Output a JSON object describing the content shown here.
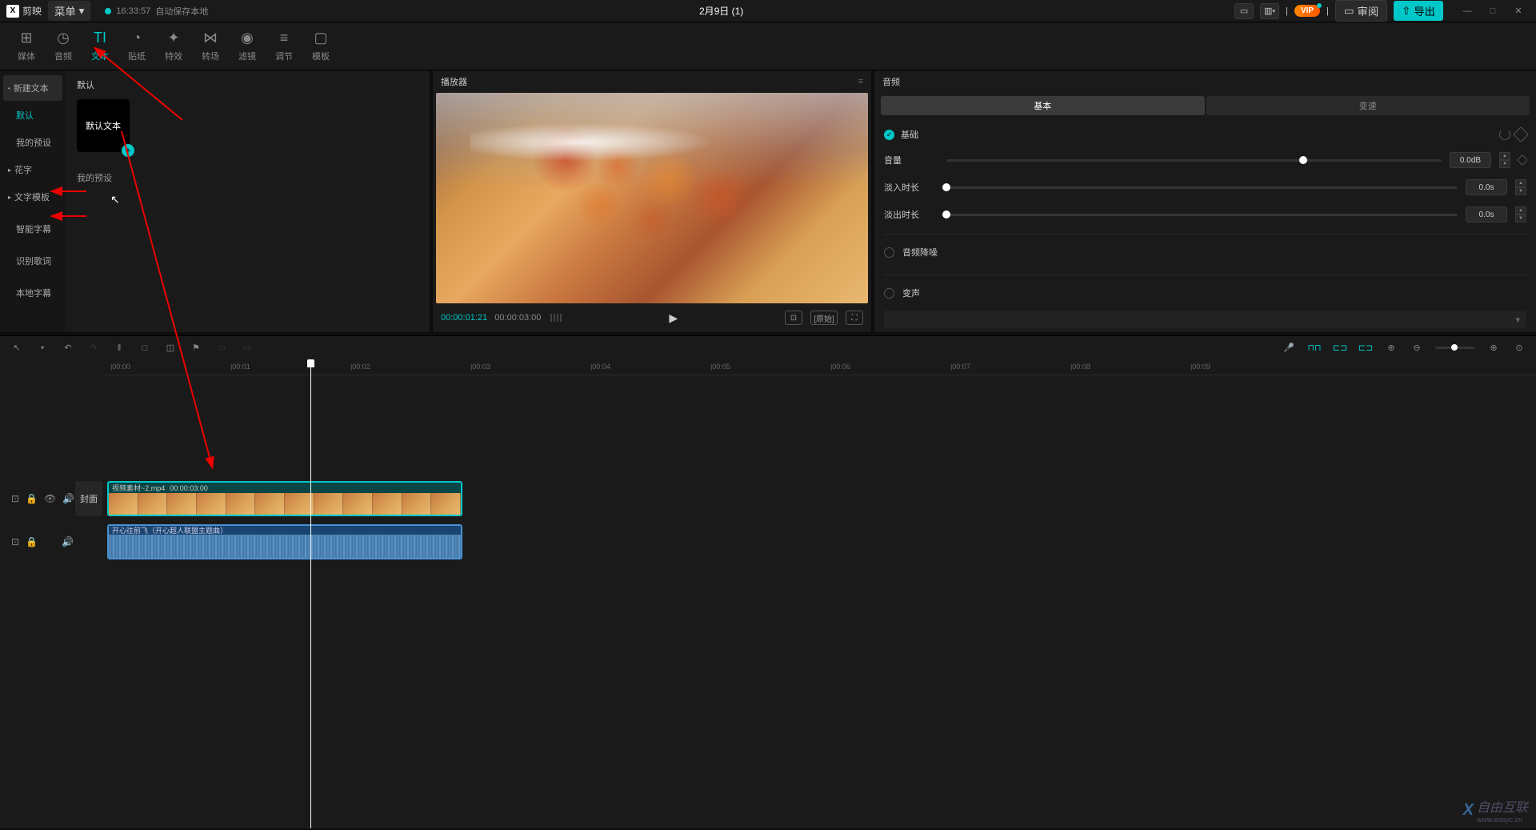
{
  "titlebar": {
    "app_name": "剪映",
    "menu_btn": "菜单",
    "autosave_time": "16:33:57",
    "autosave_text": "自动保存本地",
    "project_title": "2月9日 (1)",
    "vip": "VIP",
    "review": "审阅",
    "export": "导出"
  },
  "main_tabs": [
    {
      "icon": "⊞",
      "label": "媒体"
    },
    {
      "icon": "◷",
      "label": "音频"
    },
    {
      "icon": "TI",
      "label": "文本"
    },
    {
      "icon": "◔",
      "label": "贴纸"
    },
    {
      "icon": "✦",
      "label": "特效"
    },
    {
      "icon": "⋈",
      "label": "转场"
    },
    {
      "icon": "◉",
      "label": "滤镜"
    },
    {
      "icon": "≡",
      "label": "调节"
    },
    {
      "icon": "▢",
      "label": "模板"
    }
  ],
  "sidebar": {
    "items": [
      {
        "label": "新建文本",
        "variant": "primary",
        "bullet": true
      },
      {
        "label": "默认",
        "variant": "sub-active"
      },
      {
        "label": "我的预设",
        "variant": "sub"
      },
      {
        "label": "花字",
        "variant": "caret"
      },
      {
        "label": "文字模板",
        "variant": "caret"
      },
      {
        "label": "智能字幕",
        "variant": "plain"
      },
      {
        "label": "识别歌词",
        "variant": "plain"
      },
      {
        "label": "本地字幕",
        "variant": "plain"
      }
    ]
  },
  "content": {
    "section_default": "默认",
    "default_text_card": "默认文本",
    "my_presets": "我的预设"
  },
  "preview": {
    "title": "播放器",
    "time_current": "00:00:01:21",
    "time_total": "00:00:03:00",
    "ratio_label": "[原始]"
  },
  "audio": {
    "title": "音频",
    "tab_basic": "基本",
    "tab_variable": "变速",
    "section_basic": "基础",
    "volume_label": "音量",
    "volume_value": "0.0dB",
    "fadein_label": "淡入时长",
    "fadein_value": "0.0s",
    "fadeout_label": "淡出时长",
    "fadeout_value": "0.0s",
    "noise_label": "音频降噪",
    "voice_label": "变声"
  },
  "ruler": {
    "ticks": [
      {
        "label": "00:00",
        "pos": 8
      },
      {
        "label": "00:01",
        "pos": 158
      },
      {
        "label": "00:02",
        "pos": 308
      },
      {
        "label": "00:03",
        "pos": 458
      },
      {
        "label": "00:04",
        "pos": 608
      },
      {
        "label": "00:05",
        "pos": 758
      },
      {
        "label": "00:06",
        "pos": 908
      },
      {
        "label": "00:07",
        "pos": 1058
      },
      {
        "label": "00:08",
        "pos": 1208
      },
      {
        "label": "00:09",
        "pos": 1358
      }
    ]
  },
  "timeline": {
    "cover_label": "封面",
    "video_clip_name": "视频素材~2.mp4",
    "video_clip_time": "00:00:03:00",
    "audio_clip_name": "开心往前飞（开心超人联盟主题曲）"
  },
  "watermark": {
    "text": "自由互联",
    "url": "www.easyc.cn"
  }
}
